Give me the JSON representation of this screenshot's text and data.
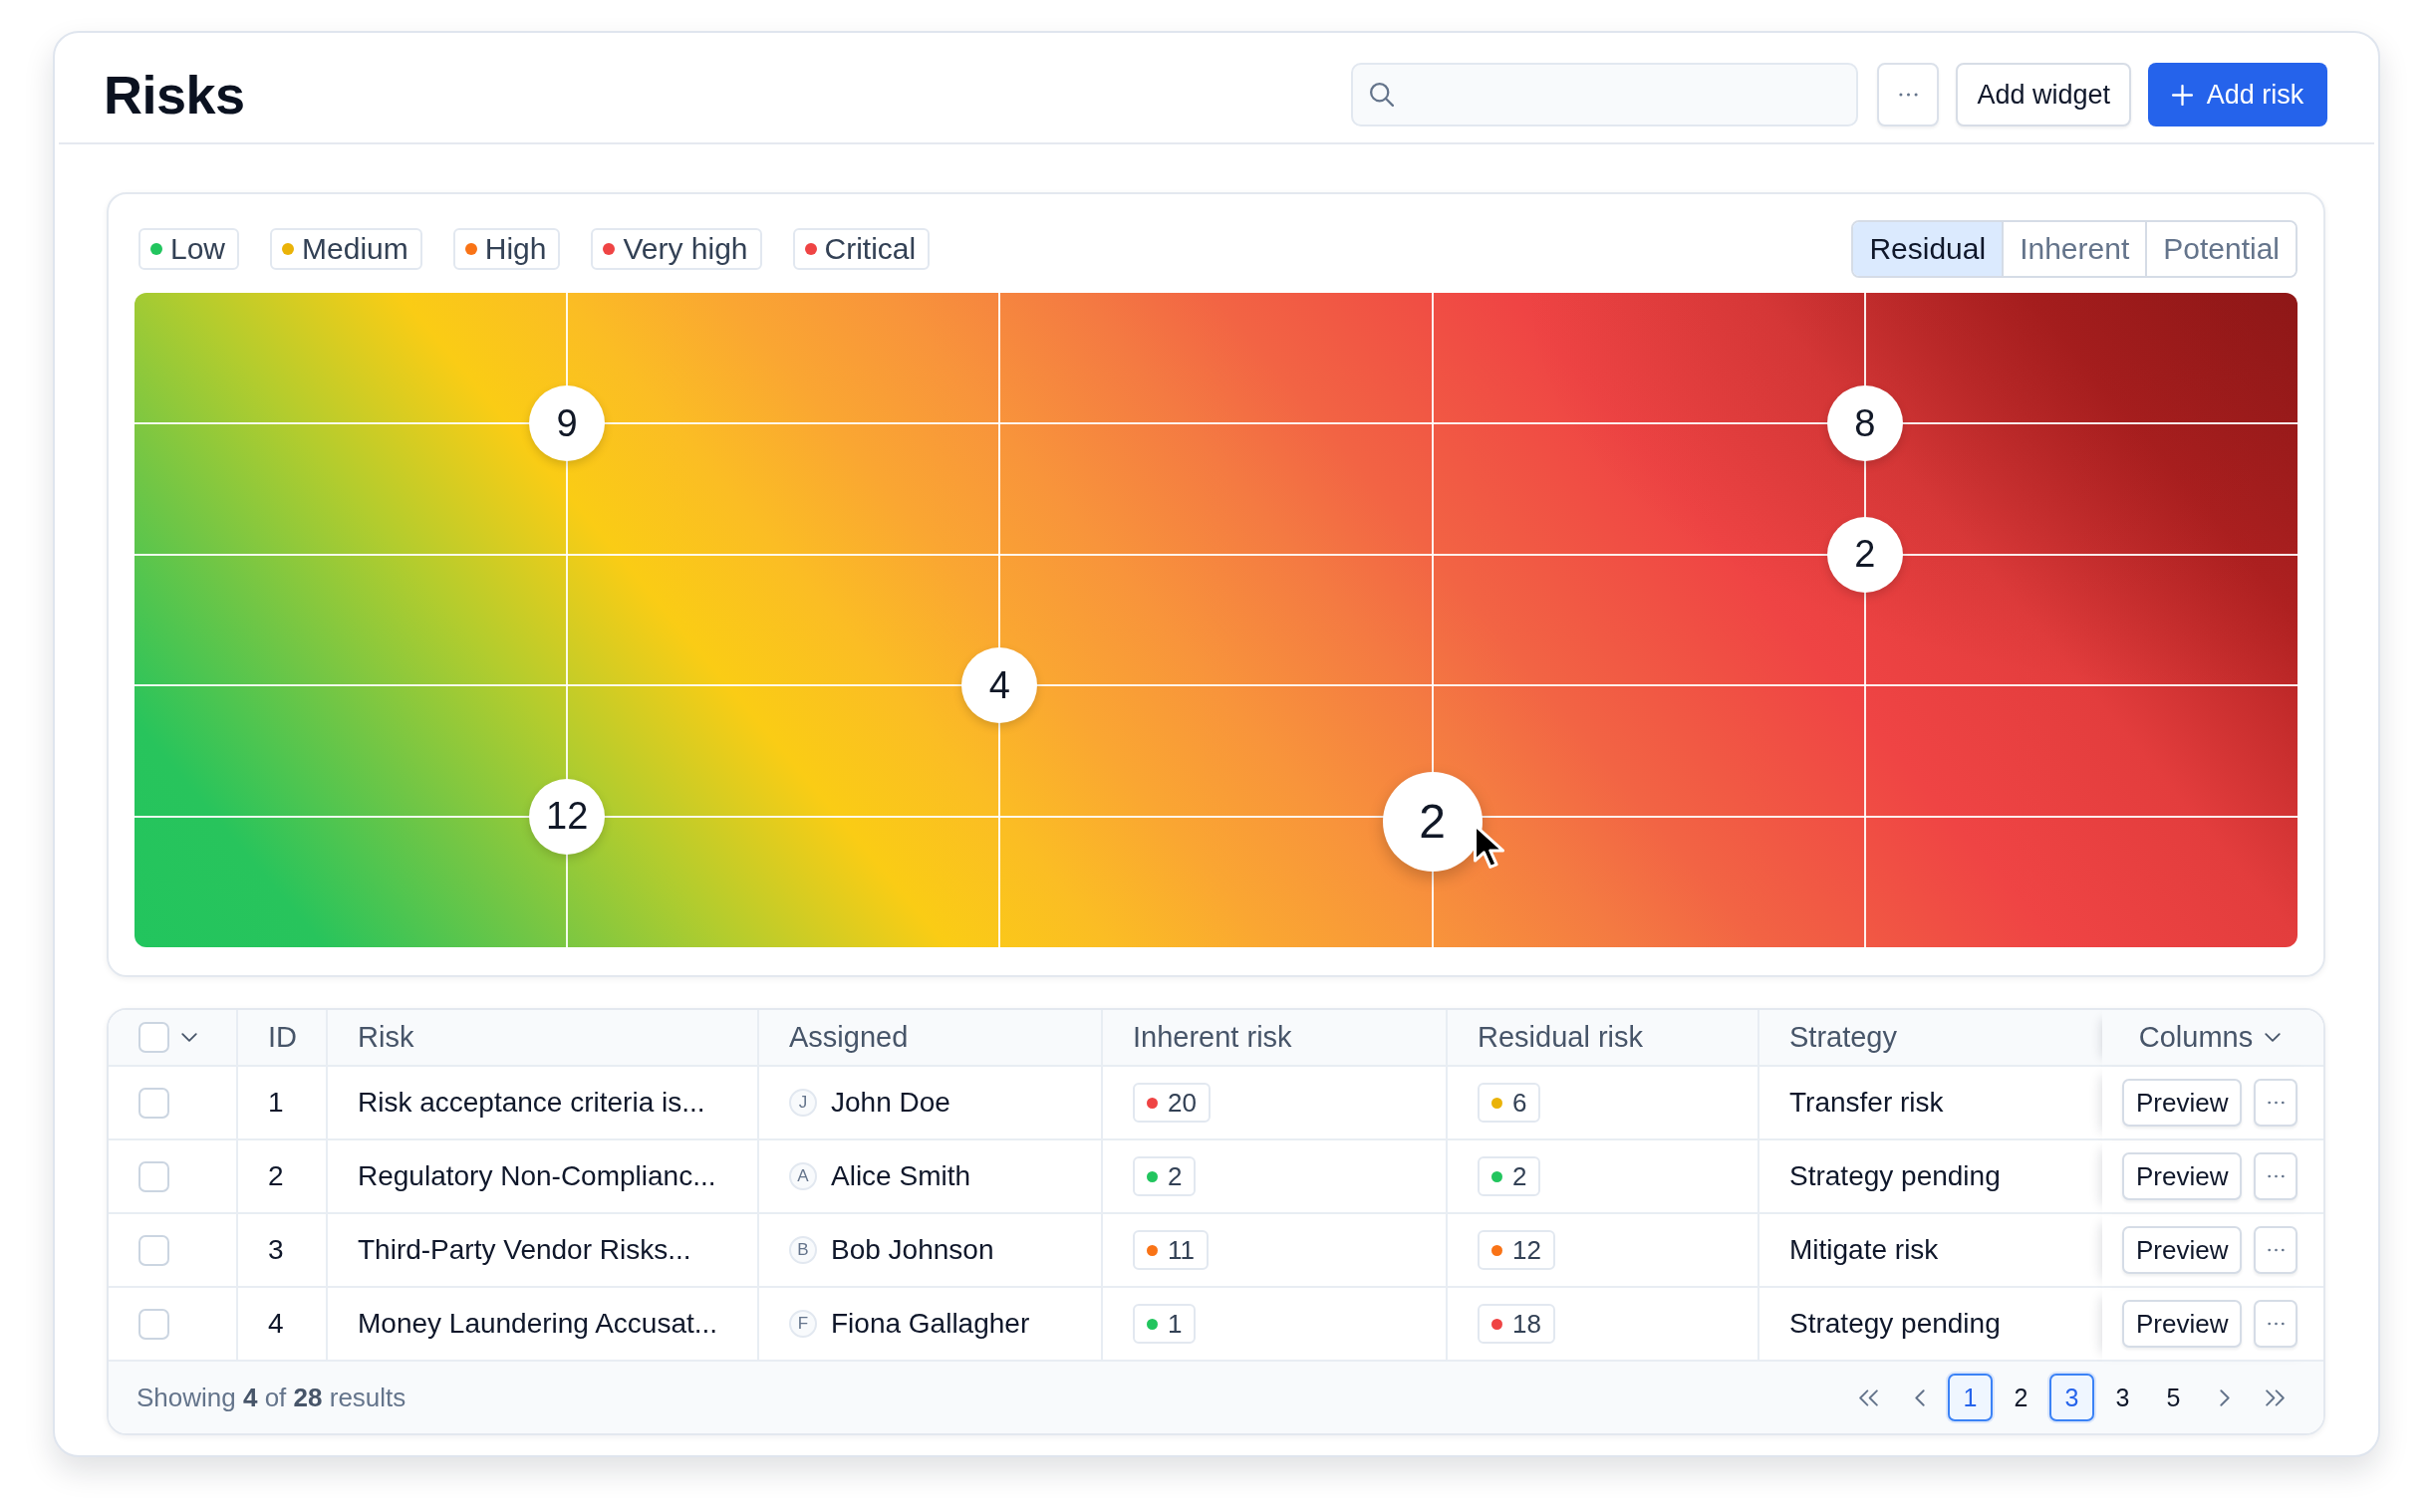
{
  "header": {
    "title": "Risks",
    "actions": [
      {
        "kind": "more"
      },
      {
        "kind": "secondary",
        "label": "Add widget"
      },
      {
        "kind": "primary",
        "label": "Add risk"
      }
    ]
  },
  "heatmap": {
    "legend": [
      {
        "label": "Low",
        "color": "#22c55e"
      },
      {
        "label": "Medium",
        "color": "#eab308"
      },
      {
        "label": "High",
        "color": "#f97316"
      },
      {
        "label": "Very high",
        "color": "#ef4444"
      },
      {
        "label": "Critical",
        "color": "#ef4444"
      }
    ],
    "views": [
      {
        "label": "Residual",
        "selected": true
      },
      {
        "label": "Inherent",
        "selected": false
      },
      {
        "label": "Potential",
        "selected": false
      }
    ],
    "grid": [
      {
        "points": [
          {
            "kind": "marker",
            "count": "9",
            "hovered": false
          },
          {
            "kind": "empty"
          },
          {
            "kind": "empty"
          },
          {
            "kind": "marker",
            "count": "8",
            "hovered": false
          }
        ]
      },
      {
        "points": [
          {
            "kind": "empty"
          },
          {
            "kind": "empty"
          },
          {
            "kind": "empty"
          },
          {
            "kind": "marker",
            "count": "2",
            "hovered": false
          }
        ]
      },
      {
        "points": [
          {
            "kind": "empty"
          },
          {
            "kind": "marker",
            "count": "4",
            "hovered": false
          },
          {
            "kind": "empty"
          },
          {
            "kind": "empty"
          }
        ]
      },
      {
        "points": [
          {
            "kind": "marker",
            "count": "12",
            "hovered": false
          },
          {
            "kind": "empty"
          },
          {
            "kind": "marker",
            "count": "2",
            "hovered": true
          },
          {
            "kind": "empty"
          }
        ]
      }
    ]
  },
  "table": {
    "columns": [
      {
        "kind": "select",
        "checked": false
      },
      {
        "kind": "text",
        "label": "ID"
      },
      {
        "kind": "text",
        "label": "Risk"
      },
      {
        "kind": "text",
        "label": "Assigned"
      },
      {
        "kind": "text",
        "label": "Inherent risk"
      },
      {
        "kind": "text",
        "label": "Residual risk"
      },
      {
        "kind": "text",
        "label": "Strategy"
      },
      {
        "kind": "menu",
        "label": "Columns"
      }
    ],
    "rows": [
      {
        "selected": false,
        "id": "1",
        "risk": "Risk acceptance criteria is...",
        "assignee": {
          "initial": "J",
          "name": "John Doe"
        },
        "inherent": {
          "score": "20",
          "color": "#ef4444"
        },
        "residual": {
          "score": "6",
          "color": "#eab308"
        },
        "strategy": "Transfer risk",
        "action": "Preview"
      },
      {
        "selected": false,
        "id": "2",
        "risk": "Regulatory Non-Complianc...",
        "assignee": {
          "initial": "A",
          "name": "Alice Smith"
        },
        "inherent": {
          "score": "2",
          "color": "#22c55e"
        },
        "residual": {
          "score": "2",
          "color": "#22c55e"
        },
        "strategy": "Strategy pending",
        "action": "Preview"
      },
      {
        "selected": false,
        "id": "3",
        "risk": "Third-Party Vendor Risks...",
        "assignee": {
          "initial": "B",
          "name": "Bob Johnson"
        },
        "inherent": {
          "score": "11",
          "color": "#f97316"
        },
        "residual": {
          "score": "12",
          "color": "#f97316"
        },
        "strategy": "Mitigate risk",
        "action": "Preview"
      },
      {
        "selected": false,
        "id": "4",
        "risk": "Money Laundering Accusat...",
        "assignee": {
          "initial": "F",
          "name": "Fiona Gallagher"
        },
        "inherent": {
          "score": "1",
          "color": "#22c55e"
        },
        "residual": {
          "score": "18",
          "color": "#ef4444"
        },
        "strategy": "Strategy pending",
        "action": "Preview"
      }
    ],
    "footer": {
      "summary": "Showing **4** of **28** results",
      "pages": [
        {
          "label": "1",
          "selected": true
        },
        {
          "label": "2",
          "selected": false
        },
        {
          "label": "3",
          "selected": true
        },
        {
          "label": "3",
          "selected": false
        },
        {
          "label": "5",
          "selected": false
        }
      ]
    }
  }
}
